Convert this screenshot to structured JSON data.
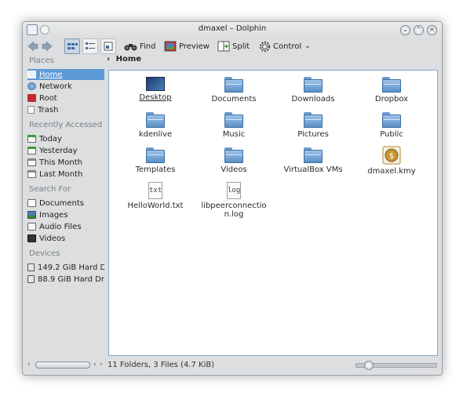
{
  "window": {
    "title": "dmaxel – Dolphin"
  },
  "toolbar": {
    "find_label": "Find",
    "preview_label": "Preview",
    "split_label": "Split",
    "control_label": "Control",
    "control_arrow": "⌄"
  },
  "sidebar": {
    "places_header": "Places",
    "places": [
      {
        "label": "Home",
        "icon": "home-icon",
        "color": "#5e9ad8"
      },
      {
        "label": "Network",
        "icon": "network-icon",
        "color": "#4a7fb5"
      },
      {
        "label": "Root",
        "icon": "root-folder-icon",
        "color": "#c0282d"
      },
      {
        "label": "Trash",
        "icon": "trash-icon",
        "color": "#ffffff"
      }
    ],
    "recent_header": "Recently Accessed",
    "recent": [
      {
        "label": "Today",
        "icon": "calendar-icon"
      },
      {
        "label": "Yesterday",
        "icon": "calendar-icon"
      },
      {
        "label": "This Month",
        "icon": "calendar-icon"
      },
      {
        "label": "Last Month",
        "icon": "calendar-icon"
      }
    ],
    "search_header": "Search For",
    "search": [
      {
        "label": "Documents",
        "icon": "documents-icon"
      },
      {
        "label": "Images",
        "icon": "images-icon"
      },
      {
        "label": "Audio Files",
        "icon": "audio-icon"
      },
      {
        "label": "Videos",
        "icon": "videos-icon"
      }
    ],
    "devices_header": "Devices",
    "devices": [
      {
        "label": "149.2 GiB Hard D",
        "icon": "hard-drive-icon"
      },
      {
        "label": "88.9 GiB Hard Dri",
        "icon": "hard-drive-icon"
      }
    ]
  },
  "breadcrumb": {
    "arrow": "›",
    "label": "Home"
  },
  "files": [
    {
      "name": "Desktop",
      "type": "desktop"
    },
    {
      "name": "Documents",
      "type": "folder"
    },
    {
      "name": "Downloads",
      "type": "folder"
    },
    {
      "name": "Dropbox",
      "type": "folder"
    },
    {
      "name": "kdenlive",
      "type": "folder"
    },
    {
      "name": "Music",
      "type": "folder"
    },
    {
      "name": "Pictures",
      "type": "folder"
    },
    {
      "name": "Public",
      "type": "folder"
    },
    {
      "name": "Templates",
      "type": "folder"
    },
    {
      "name": "Videos",
      "type": "folder"
    },
    {
      "name": "VirtualBox VMs",
      "type": "folder"
    },
    {
      "name": "dmaxel.kmy",
      "type": "kmy"
    },
    {
      "name": "HelloWorld.txt",
      "type": "text",
      "glyph": "txt"
    },
    {
      "name": "libpeerconnection.log",
      "name_line1": "libpeerconnectio",
      "name_line2": "n.log",
      "type": "text",
      "glyph": "log"
    }
  ],
  "status": {
    "summary": "11 Folders, 3 Files (4.7 KiB)"
  },
  "colors": {
    "accent": "#5e9ad8",
    "folder": "#6b9dd0",
    "view_border": "#7fa9d4"
  }
}
